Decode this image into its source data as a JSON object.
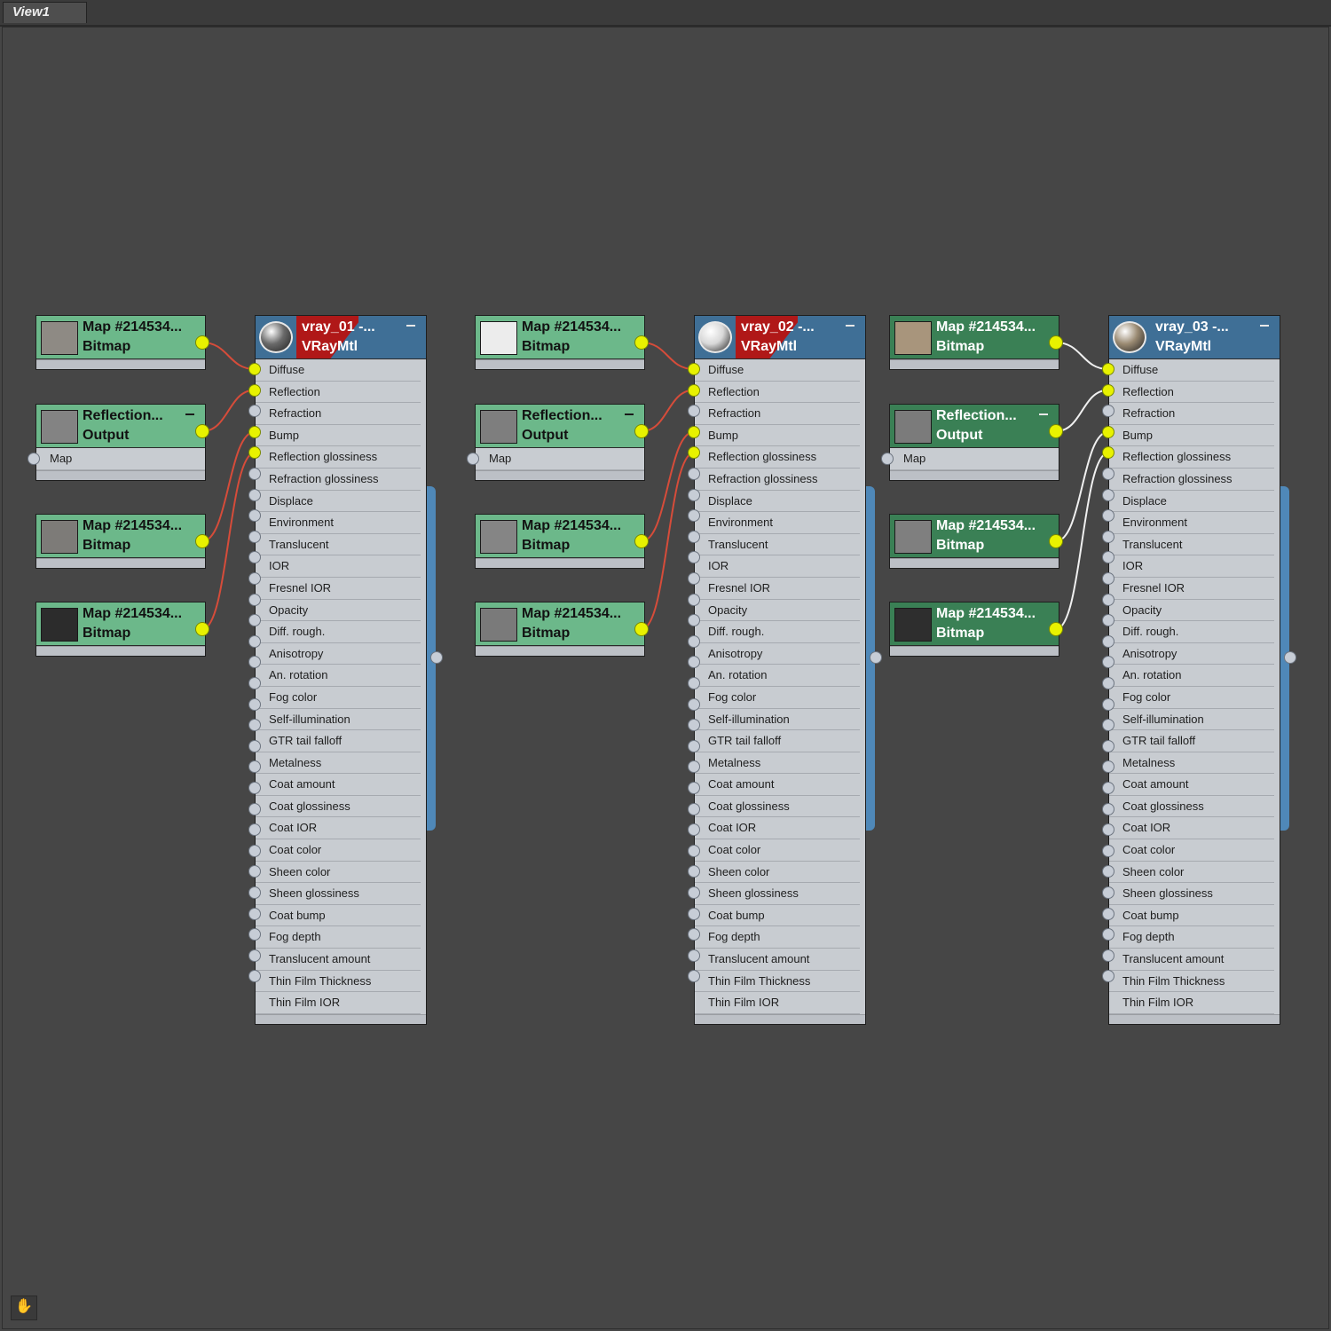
{
  "view_tab": "View1",
  "colors": {
    "canvas": "#464646",
    "bitmap_light": "#6cb88a",
    "bitmap_dark": "#3a8055",
    "material_header": "#3f6f96",
    "material_flag": "#b01818",
    "socket_active": "#e8f200",
    "wire_red": "#d64c3a",
    "wire_white": "#f0f0f0"
  },
  "slot_labels": [
    "Diffuse",
    "Reflection",
    "Refraction",
    "Bump",
    "Reflection glossiness",
    "Refraction glossiness",
    "Displace",
    "Environment",
    "Translucent",
    "IOR",
    "Fresnel IOR",
    "Opacity",
    "Diff. rough.",
    "Anisotropy",
    "An. rotation",
    "Fog color",
    "Self-illumination",
    "GTR tail falloff",
    "Metalness",
    "Coat amount",
    "Coat glossiness",
    "Coat IOR",
    "Coat color",
    "Sheen color",
    "Sheen glossiness",
    "Coat bump",
    "Fog depth",
    "Translucent amount",
    "Thin Film Thickness",
    "Thin Film IOR"
  ],
  "groups": [
    {
      "material": {
        "name": "vray_01 -...",
        "type": "VRayMtl"
      },
      "maps": [
        {
          "kind": "bitmap",
          "name": "Map #214534...",
          "type": "Bitmap",
          "swatch": "#8e8a84"
        },
        {
          "kind": "output",
          "name": "Reflection...",
          "type": "Output",
          "input": "Map",
          "swatch": "#838383"
        },
        {
          "kind": "bitmap",
          "name": "Map #214534...",
          "type": "Bitmap",
          "swatch": "#7d7b78"
        },
        {
          "kind": "bitmap",
          "name": "Map #214534...",
          "type": "Bitmap",
          "swatch": "#2c2c2c"
        }
      ]
    },
    {
      "material": {
        "name": "vray_02 -...",
        "type": "VRayMtl"
      },
      "maps": [
        {
          "kind": "bitmap",
          "name": "Map #214534...",
          "type": "Bitmap",
          "swatch": "#ececec"
        },
        {
          "kind": "output",
          "name": "Reflection...",
          "type": "Output",
          "input": "Map",
          "swatch": "#7e7e7e"
        },
        {
          "kind": "bitmap",
          "name": "Map #214534...",
          "type": "Bitmap",
          "swatch": "#858585"
        },
        {
          "kind": "bitmap",
          "name": "Map #214534...",
          "type": "Bitmap",
          "swatch": "#7a7a7a"
        }
      ]
    },
    {
      "material": {
        "name": "vray_03 -...",
        "type": "VRayMtl"
      },
      "maps": [
        {
          "kind": "bitmap",
          "name": "Map #214534...",
          "type": "Bitmap",
          "swatch": "#a8957c"
        },
        {
          "kind": "output",
          "name": "Reflection...",
          "type": "Output",
          "input": "Map",
          "swatch": "#7b7b7b"
        },
        {
          "kind": "bitmap",
          "name": "Map #214534...",
          "type": "Bitmap",
          "swatch": "#7f7f7f"
        },
        {
          "kind": "bitmap",
          "name": "Map #214534...",
          "type": "Bitmap",
          "swatch": "#2e2e2e"
        }
      ]
    }
  ]
}
